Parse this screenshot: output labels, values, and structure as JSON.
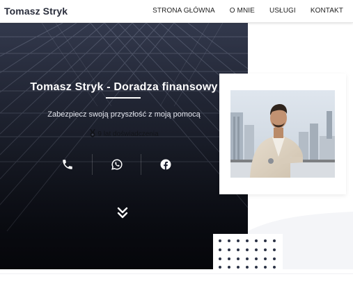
{
  "header": {
    "logo": "Tomasz Stryk",
    "nav": [
      {
        "label": "STRONA GŁÓWNA"
      },
      {
        "label": "O MNIE"
      },
      {
        "label": "USŁUGI"
      },
      {
        "label": "KONTAKT"
      }
    ]
  },
  "hero": {
    "title": "Tomasz Stryk - Doradza finansowy",
    "subtitle": "Zabezpiecz swoją przyszłość z moją pomocą",
    "experience_icon": "medal-icon",
    "experience": "9 lat doświadczenia",
    "socials": [
      {
        "icon": "phone-icon"
      },
      {
        "icon": "whatsapp-icon"
      },
      {
        "icon": "facebook-icon"
      }
    ],
    "scroll_icon": "double-chevron-down-icon"
  },
  "colors": {
    "hero_dark": "#1c2030",
    "accent_dots": "#2b3245",
    "light_bg": "#f4f5f8"
  }
}
